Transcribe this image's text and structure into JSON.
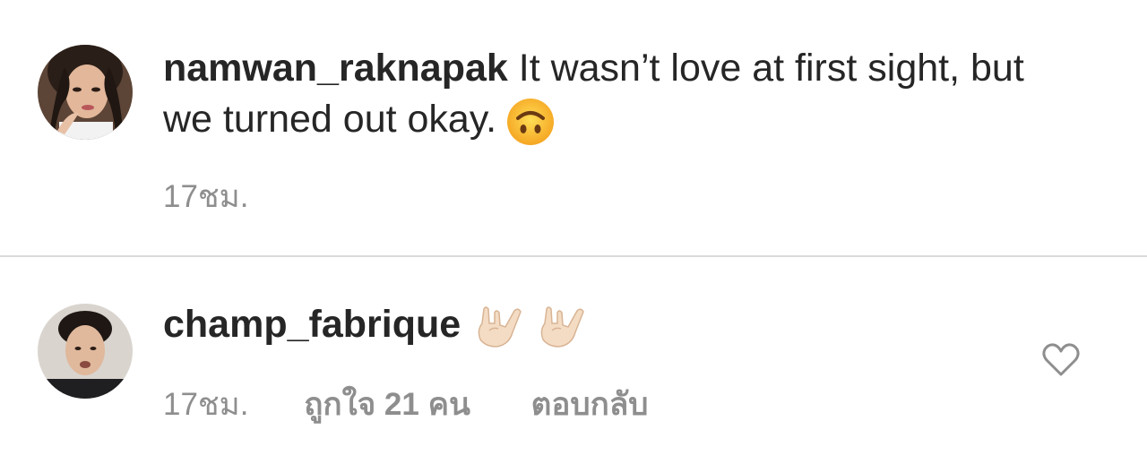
{
  "comments": [
    {
      "username": "namwan_raknapak",
      "text": " It wasn’t love at first sight, but we turned out okay.",
      "emoji": "upside-down-face-emoji",
      "time": "17ชม.",
      "avatar": "avatar-photo-woman"
    },
    {
      "username": "champ_fabrique",
      "emoji": "love-you-gesture-emoji",
      "time": "17ชม.",
      "likes": "ถูกใจ 21 คน",
      "reply": "ตอบกลับ",
      "avatar": "avatar-photo-man",
      "like_icon": "heart-outline-icon"
    }
  ],
  "colors": {
    "primary_text": "#262626",
    "secondary_text": "#8e8e8e",
    "divider": "#dbdbdb",
    "background": "#ffffff"
  }
}
